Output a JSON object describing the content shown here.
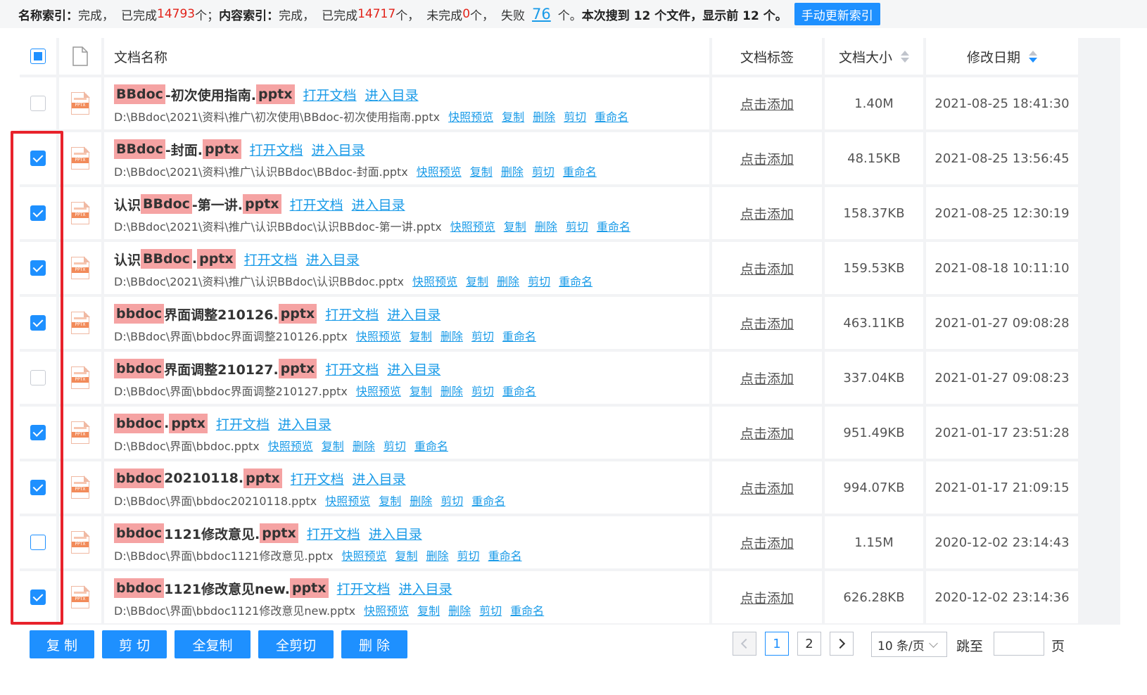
{
  "status": {
    "name_index_label": "名称索引：",
    "name_index_state": "完成，",
    "name_done_prefix": "已完成",
    "name_done_count": "14793",
    "name_done_suffix": "个；",
    "content_index_label": "内容索引：",
    "content_index_state": "完成，",
    "content_done_prefix": "已完成",
    "content_done_count": "14717",
    "content_done_suffix": "个，",
    "undone_prefix": "未完成",
    "undone_count": "0",
    "undone_suffix": "个，",
    "fail_prefix": "失败",
    "fail_count": "76",
    "fail_suffix": "个。",
    "summary": "本次搜到 12 个文件，显示前 12 个。",
    "refresh_button": "手动更新索引"
  },
  "columns": {
    "name": "文档名称",
    "tag": "文档标签",
    "size": "文档大小",
    "date": "修改日期"
  },
  "file_type_badge": "PPTX",
  "row_actions": {
    "open": "打开文档",
    "enter_dir": "进入目录",
    "preview": "快照预览",
    "copy": "复制",
    "delete": "删除",
    "cut": "剪切",
    "rename": "重命名",
    "add_tag": "点击添加"
  },
  "rows": [
    {
      "checked": false,
      "name_parts": [
        {
          "t": "BBdoc",
          "hl": true
        },
        {
          "t": "-初次使用指南.",
          "hl": false
        },
        {
          "t": "pptx",
          "hl": true
        }
      ],
      "path": "D:\\BBdoc\\2021\\资料\\推广\\初次使用\\BBdoc-初次使用指南.pptx",
      "size": "1.40M",
      "date": "2021-08-25 18:41:30"
    },
    {
      "checked": true,
      "name_parts": [
        {
          "t": "BBdoc",
          "hl": true
        },
        {
          "t": "-封面.",
          "hl": false
        },
        {
          "t": "pptx",
          "hl": true
        }
      ],
      "path": "D:\\BBdoc\\2021\\资料\\推广\\认识BBdoc\\BBdoc-封面.pptx",
      "size": "48.15KB",
      "date": "2021-08-25 13:56:45"
    },
    {
      "checked": true,
      "name_parts": [
        {
          "t": "认识",
          "hl": false
        },
        {
          "t": "BBdoc",
          "hl": true
        },
        {
          "t": "-第一讲.",
          "hl": false
        },
        {
          "t": "pptx",
          "hl": true
        }
      ],
      "path": "D:\\BBdoc\\2021\\资料\\推广\\认识BBdoc\\认识BBdoc-第一讲.pptx",
      "size": "158.37KB",
      "date": "2021-08-25 12:30:19"
    },
    {
      "checked": true,
      "name_parts": [
        {
          "t": "认识",
          "hl": false
        },
        {
          "t": "BBdoc",
          "hl": true
        },
        {
          "t": ".",
          "hl": false
        },
        {
          "t": "pptx",
          "hl": true
        }
      ],
      "path": "D:\\BBdoc\\2021\\资料\\推广\\认识BBdoc\\认识BBdoc.pptx",
      "size": "159.53KB",
      "date": "2021-08-18 10:11:10"
    },
    {
      "checked": true,
      "name_parts": [
        {
          "t": "bbdoc",
          "hl": true
        },
        {
          "t": "界面调整210126.",
          "hl": false
        },
        {
          "t": "pptx",
          "hl": true
        }
      ],
      "path": "D:\\BBdoc\\界面\\bbdoc界面调整210126.pptx",
      "size": "463.11KB",
      "date": "2021-01-27 09:08:28"
    },
    {
      "checked": false,
      "name_parts": [
        {
          "t": "bbdoc",
          "hl": true
        },
        {
          "t": "界面调整210127.",
          "hl": false
        },
        {
          "t": "pptx",
          "hl": true
        }
      ],
      "path": "D:\\BBdoc\\界面\\bbdoc界面调整210127.pptx",
      "size": "337.04KB",
      "date": "2021-01-27 09:08:23"
    },
    {
      "checked": true,
      "name_parts": [
        {
          "t": "bbdoc",
          "hl": true
        },
        {
          "t": ".",
          "hl": false
        },
        {
          "t": "pptx",
          "hl": true
        }
      ],
      "path": "D:\\BBdoc\\界面\\bbdoc.pptx",
      "size": "951.49KB",
      "date": "2021-01-17 23:51:28"
    },
    {
      "checked": true,
      "name_parts": [
        {
          "t": "bbdoc",
          "hl": true
        },
        {
          "t": "20210118.",
          "hl": false
        },
        {
          "t": "pptx",
          "hl": true
        }
      ],
      "path": "D:\\BBdoc\\界面\\bbdoc20210118.pptx",
      "size": "994.07KB",
      "date": "2021-01-17 21:09:15"
    },
    {
      "checked": false,
      "focus": true,
      "name_parts": [
        {
          "t": "bbdoc",
          "hl": true
        },
        {
          "t": "1121修改意见.",
          "hl": false
        },
        {
          "t": "pptx",
          "hl": true
        }
      ],
      "path": "D:\\BBdoc\\界面\\bbdoc1121修改意见.pptx",
      "size": "1.15M",
      "date": "2020-12-02 23:14:43"
    },
    {
      "checked": true,
      "name_parts": [
        {
          "t": "bbdoc",
          "hl": true
        },
        {
          "t": "1121修改意见new.",
          "hl": false
        },
        {
          "t": "pptx",
          "hl": true
        }
      ],
      "path": "D:\\BBdoc\\界面\\bbdoc1121修改意见new.pptx",
      "size": "626.28KB",
      "date": "2020-12-02 23:14:36"
    }
  ],
  "bottom": {
    "copy": "复 制",
    "cut": "剪 切",
    "copy_all": "全复制",
    "cut_all": "全剪切",
    "delete": "删 除",
    "pages": [
      "1",
      "2"
    ],
    "current_page": "1",
    "page_size": "10 条/页",
    "jump_to": "跳至",
    "page_unit": "页"
  }
}
